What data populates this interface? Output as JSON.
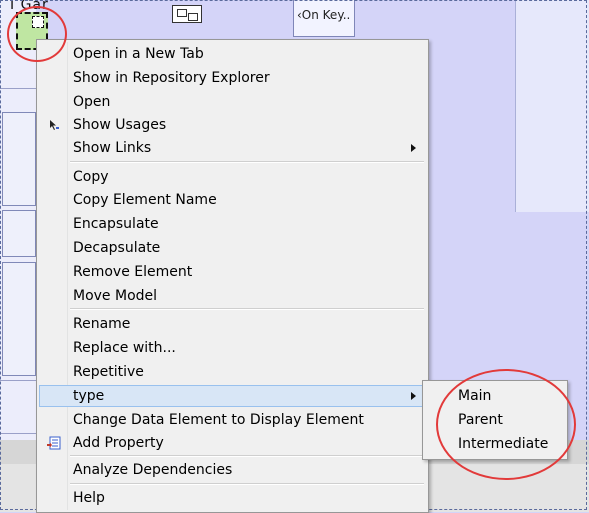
{
  "canvas": {
    "top_box_label": "‹On Key..",
    "top_text": "I Gar"
  },
  "context_menu": {
    "items": [
      {
        "label": "Open in a New Tab"
      },
      {
        "label": "Show in Repository Explorer"
      },
      {
        "label": "Open"
      },
      {
        "label": "Show Usages",
        "icon": "usages-cursor-icon"
      },
      {
        "label": "Show Links",
        "submenu": true
      },
      {
        "label": "Copy"
      },
      {
        "label": "Copy Element Name"
      },
      {
        "label": "Encapsulate"
      },
      {
        "label": "Decapsulate"
      },
      {
        "label": "Remove Element"
      },
      {
        "label": "Move Model"
      },
      {
        "label": "Rename"
      },
      {
        "label": "Replace with..."
      },
      {
        "label": "Repetitive"
      },
      {
        "label": "type",
        "submenu": true,
        "highlighted": true
      },
      {
        "label": "Change Data Element to Display Element"
      },
      {
        "label": "Add Property",
        "icon": "add-property-icon"
      },
      {
        "label": "Analyze Dependencies"
      },
      {
        "label": "Help"
      }
    ]
  },
  "type_submenu": {
    "items": [
      "Main",
      "Parent",
      "Intermediate"
    ]
  },
  "colors": {
    "highlight_bg": "#d8e6f6",
    "annotation_circle": "#e23a3a",
    "canvas_bg": "#d4d4f8"
  }
}
